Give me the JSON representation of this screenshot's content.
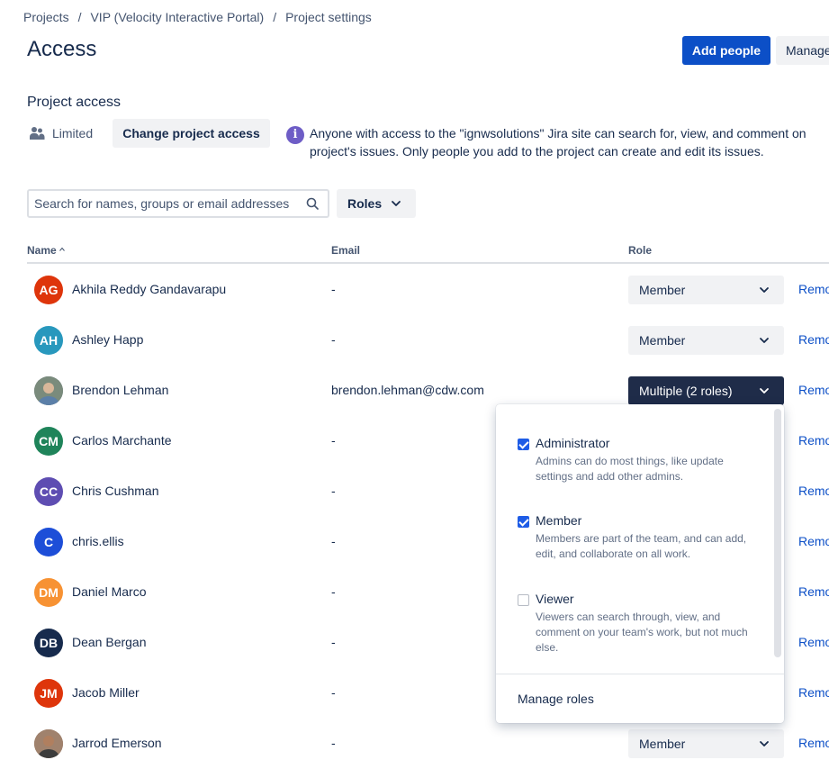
{
  "breadcrumb": {
    "item1": "Projects",
    "item2": "VIP (Velocity Interactive Portal)",
    "item3": "Project settings",
    "sep": "/"
  },
  "page": {
    "title": "Access"
  },
  "header": {
    "add_people": "Add people",
    "manage": "Manage"
  },
  "project_access": {
    "title": "Project access",
    "level": "Limited",
    "change_button": "Change project access",
    "info_icon_glyph": "i",
    "info_text": "Anyone with access to the \"ignwsolutions\" Jira site can search for, view, and comment on project's issues. Only people you add to the project can create and edit its issues."
  },
  "search": {
    "placeholder": "Search for names, groups or email addresses"
  },
  "roles_filter": {
    "label": "Roles"
  },
  "table": {
    "col_name": "Name",
    "col_email": "Email",
    "col_role": "Role",
    "remove_label": "Remove",
    "rows": [
      {
        "initials": "AG",
        "color": "#de350b",
        "name": "Akhila Reddy Gandavarapu",
        "email": "-",
        "role": "Member"
      },
      {
        "initials": "AH",
        "color": "#2898bd",
        "name": "Ashley Happ",
        "email": "-",
        "role": "Member"
      },
      {
        "initials": "",
        "color": "#6b778c",
        "name": "Brendon Lehman",
        "email": "brendon.lehman@cdw.com",
        "role": "Multiple (2 roles)"
      },
      {
        "initials": "CM",
        "color": "#1f845a",
        "name": "Carlos Marchante",
        "email": "-",
        "role": ""
      },
      {
        "initials": "CC",
        "color": "#5e4db2",
        "name": "Chris Cushman",
        "email": "-",
        "role": ""
      },
      {
        "initials": "C",
        "color": "#1d4ed8",
        "name": "chris.ellis",
        "email": "-",
        "role": ""
      },
      {
        "initials": "DM",
        "color": "#f79233",
        "name": "Daniel Marco",
        "email": "-",
        "role": ""
      },
      {
        "initials": "DB",
        "color": "#172b4d",
        "name": "Dean Bergan",
        "email": "-",
        "role": ""
      },
      {
        "initials": "JM",
        "color": "#de350b",
        "name": "Jacob Miller",
        "email": "-",
        "role": ""
      },
      {
        "initials": "",
        "color": "#8c6a55",
        "name": "Jarrod Emerson",
        "email": "-",
        "role": "Member"
      }
    ]
  },
  "role_dropdown": {
    "options": [
      {
        "title": "Administrator",
        "desc": "Admins can do most things, like update settings and add other admins.",
        "checked": true
      },
      {
        "title": "Member",
        "desc": "Members are part of the team, and can add, edit, and collaborate on all work.",
        "checked": true
      },
      {
        "title": "Viewer",
        "desc": "Viewers can search through, view, and comment on your team's work, but not much else.",
        "checked": false
      }
    ],
    "manage_roles": "Manage roles"
  },
  "colors": {
    "primary": "#0c4fc7",
    "active_select": "#1f2c49",
    "info": "#6e5dc6",
    "checkbox": "#1e5ce6"
  }
}
